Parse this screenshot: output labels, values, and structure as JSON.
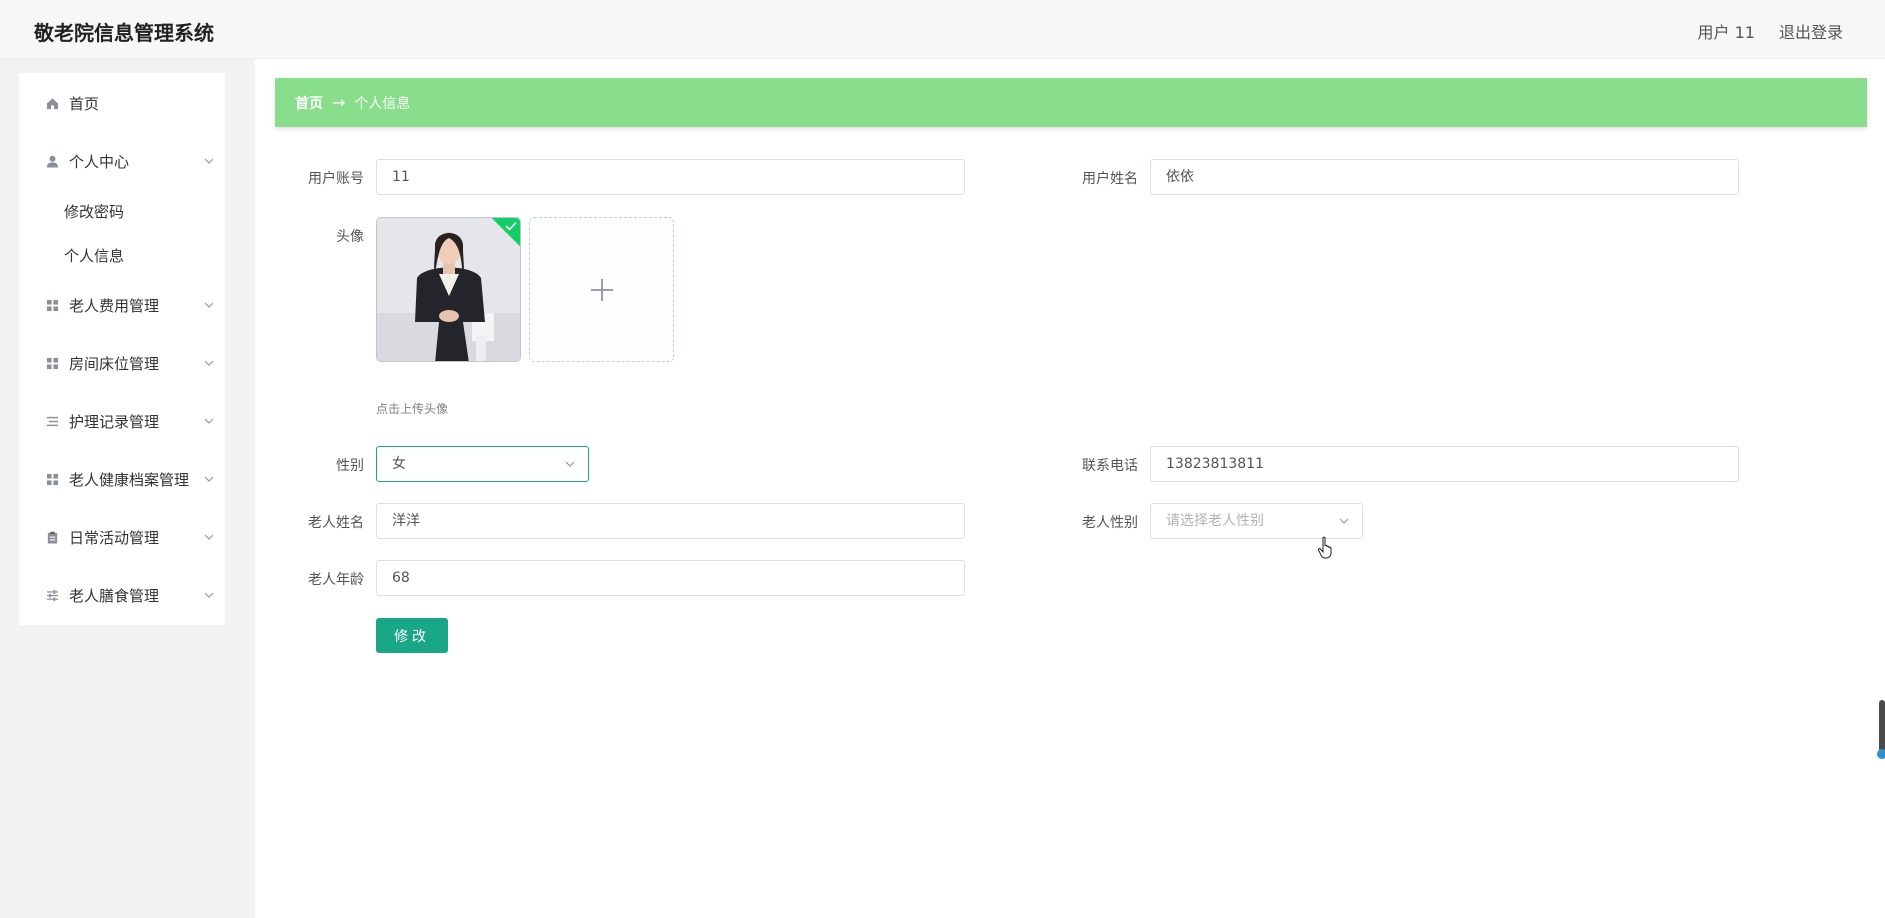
{
  "header": {
    "title": "敬老院信息管理系统",
    "user": "用户 11",
    "logout": "退出登录"
  },
  "sidebar": {
    "items": [
      {
        "label": "首页",
        "icon": "home-icon"
      },
      {
        "label": "个人中心",
        "icon": "user-icon",
        "expanded": true,
        "children": [
          "修改密码",
          "个人信息"
        ]
      },
      {
        "label": "老人费用管理",
        "icon": "grid-icon"
      },
      {
        "label": "房间床位管理",
        "icon": "grid-icon"
      },
      {
        "label": "护理记录管理",
        "icon": "list-icon"
      },
      {
        "label": "老人健康档案管理",
        "icon": "grid-icon"
      },
      {
        "label": "日常活动管理",
        "icon": "clipboard-icon"
      },
      {
        "label": "老人膳食管理",
        "icon": "sliders-icon"
      }
    ]
  },
  "breadcrumb": {
    "home": "首页",
    "separator": "→",
    "current": "个人信息"
  },
  "form": {
    "account_label": "用户账号",
    "account_value": "11",
    "name_label": "用户姓名",
    "name_value": "依依",
    "avatar_label": "头像",
    "avatar_hint": "点击上传头像",
    "gender_label": "性别",
    "gender_value": "女",
    "phone_label": "联系电话",
    "phone_value": "13823813811",
    "elder_name_label": "老人姓名",
    "elder_name_value": "洋洋",
    "elder_gender_label": "老人性别",
    "elder_gender_placeholder": "请选择老人性别",
    "elder_age_label": "老人年龄",
    "elder_age_value": "68",
    "submit_label": "修改"
  },
  "colors": {
    "accent": "#1aa788",
    "breadcrumb_bg": "#88de8b",
    "success_badge": "#13ce66"
  }
}
